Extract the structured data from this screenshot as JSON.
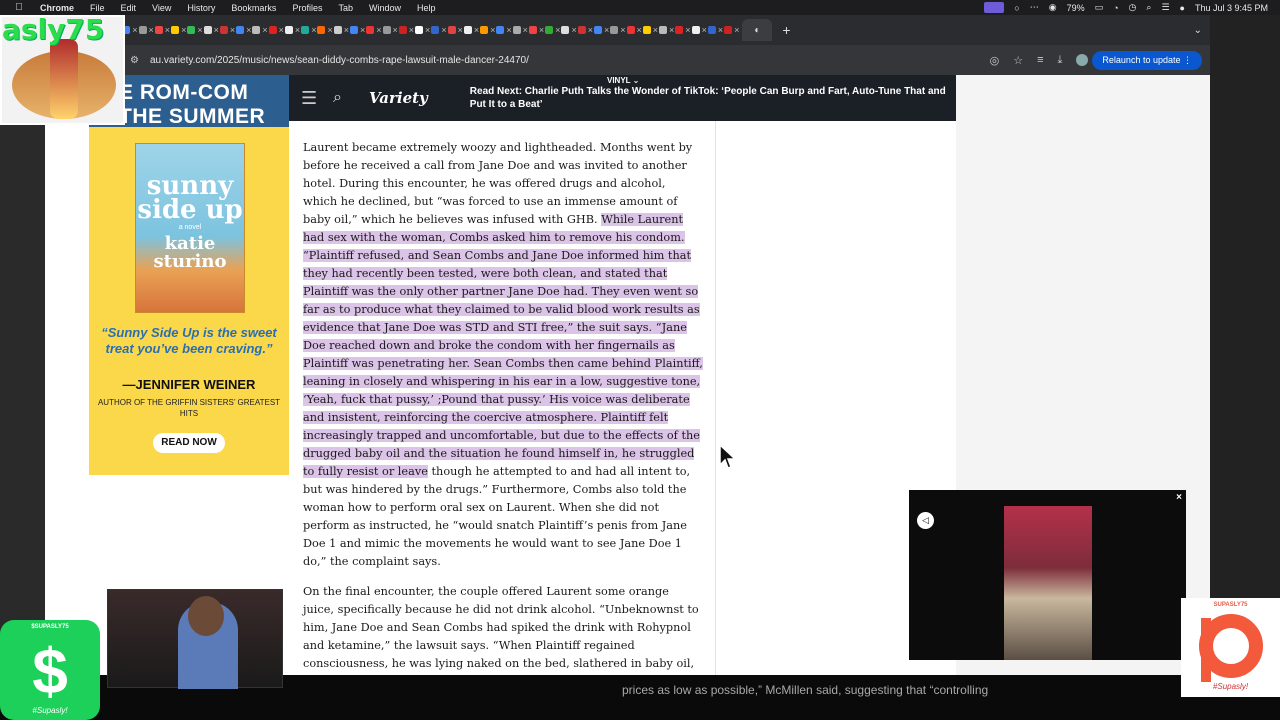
{
  "menubar": {
    "app": "Chrome",
    "items": [
      "File",
      "Edit",
      "View",
      "History",
      "Bookmarks",
      "Profiles",
      "Tab",
      "Window",
      "Help"
    ],
    "battery": "79%",
    "datetime": "Thu Jul 3  9:45 PM"
  },
  "browser": {
    "url": "au.variety.com/2025/music/news/sean-diddy-combs-rape-lawsuit-male-dancer-24470/",
    "relaunch_label": "Relaunch to update"
  },
  "ad": {
    "banner_line1": "E ROM-COM",
    "banner_line2": "THE SUMMER",
    "book_title_1": "sunny side up",
    "book_subtitle": "a novel",
    "book_author": "katie sturino",
    "quote": "“Sunny Side Up is the sweet treat you’ve been craving.”",
    "author": "—JENNIFER WEINER",
    "author_sub": "AUTHOR OF THE GRIFFIN SISTERS’ GREATEST HITS",
    "button": "READ NOW"
  },
  "variety": {
    "logo": "Variety",
    "vinyl": "VINYL",
    "read_next": "Read Next: Charlie Puth Talks the Wonder of TikTok: ‘People Can Burp and Fart, Auto-Tune That and Put It to a Beat’"
  },
  "article": {
    "p1_plain": "Laurent became extremely woozy and lightheaded. Months went by before he received a call from Jane Doe and was invited to another hotel. During this encounter, he was offered drugs and alcohol, which he declined, but “was forced to use an immense amount of baby oil,” which he believes was infused with GHB. ",
    "p1_highlight": "While Laurent had sex with the woman, Combs asked him to remove his condom. “Plaintiff refused, and Sean Combs and Jane Doe informed him that they had recently been tested, were both clean, and stated that Plaintiff was the only other partner Jane Doe had. They even went so far as to produce what they claimed to be valid blood work results as evidence that Jane Doe was STD and STI free,” the suit says. “Jane Doe reached down and broke the condom with her fingernails as Plaintiff was penetrating her. Sean Combs then came behind Plaintiff, leaning in closely and whispering in his ear in a low, suggestive tone, ‘Yeah, fuck that pussy,’ ;Pound that pussy.’ His voice was deliberate and insistent, reinforcing the coercive atmosphere. Plaintiff felt increasingly trapped and uncomfortable, but due to the effects of the drugged baby oil and the situation he found himself in, he struggled to fully resist or leave",
    "p1_tail": " though he attempted to and had all intent to, but was hindered by the drugs.” Furthermore, Combs also told the woman how to perform oral sex on Laurent. When she did not perform as instructed, he “would snatch Plaintiff’s penis from Jane Doe 1 and mimic the movements he would want to see Jane Doe 1 do,” the complaint says.",
    "p2": "On the final encounter, the couple offered Laurent some orange juice, specifically because he did not drink alcohol. “Unbeknownst to him, Jane Doe and Sean Combs had spiked the drink with Rohypnol and ketamine,” the lawsuit says. “When Plaintiff regained consciousness, he was lying naked on the bed, slathered in baby oil, and felt immense pressure and pain in his rectum. … Jane Doe woke up, pulled out a"
  },
  "overlay": {
    "streamer_name": "asly75",
    "cashapp_label": "$SUPASLY75",
    "cashapp_symbol": "$",
    "cashapp_sig": "#Supasly!",
    "patreon_label": "SUPASLY75",
    "patreon_sig": "#Supasly!",
    "caption": "prices as low as possible,” McMillen said, suggesting that “controlling"
  }
}
